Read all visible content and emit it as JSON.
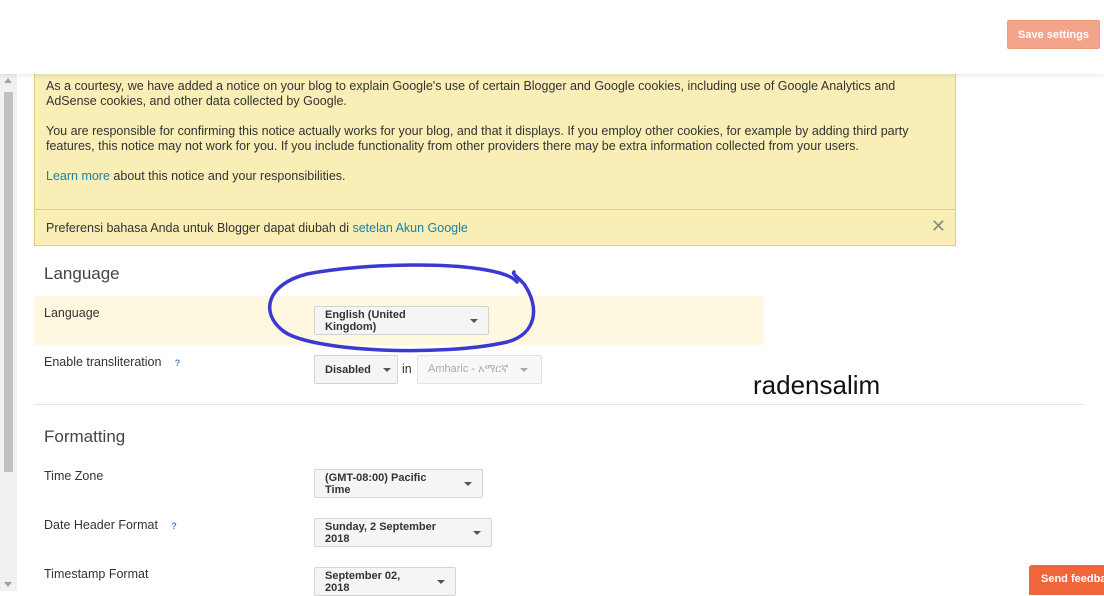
{
  "header": {
    "save_label": "Save settings"
  },
  "notice": {
    "para1": "As a courtesy, we have added a notice on your blog to explain Google's use of certain Blogger and Google cookies, including use of Google Analytics and AdSense cookies, and other data collected by Google.",
    "para2": "You are responsible for confirming this notice actually works for your blog, and that it displays. If you employ other cookies, for example by adding third party features, this notice may not work for you. If you include functionality from other providers there may be extra information collected from your users.",
    "learn_more_link": "Learn more",
    "learn_more_rest": " about this notice and your responsibilities."
  },
  "lang_notice": {
    "text": "Preferensi bahasa Anda untuk Blogger dapat diubah di ",
    "link": "setelan Akun Google",
    "close_icon": "close-icon"
  },
  "language_section": {
    "title": "Language",
    "language_label": "Language",
    "language_value": "English (United Kingdom)",
    "translit_label": "Enable transliteration",
    "translit_help": "?",
    "translit_value": "Disabled",
    "in_label": "in",
    "translit_lang_value": "Amharic - አማርኛ"
  },
  "formatting_section": {
    "title": "Formatting",
    "timezone_label": "Time Zone",
    "timezone_value": "(GMT-08:00) Pacific Time",
    "date_header_label": "Date Header Format",
    "date_header_help": "?",
    "date_header_value": "Sunday, 2 September 2018",
    "timestamp_label": "Timestamp Format",
    "timestamp_value": "September 02, 2018"
  },
  "watermark": "radensalim",
  "feedback_label": "Send feedba",
  "colors": {
    "accent": "#f0653a",
    "notice_bg": "#f9eeb5",
    "link": "#1a7fa8",
    "annotation": "#3a3ad0"
  }
}
